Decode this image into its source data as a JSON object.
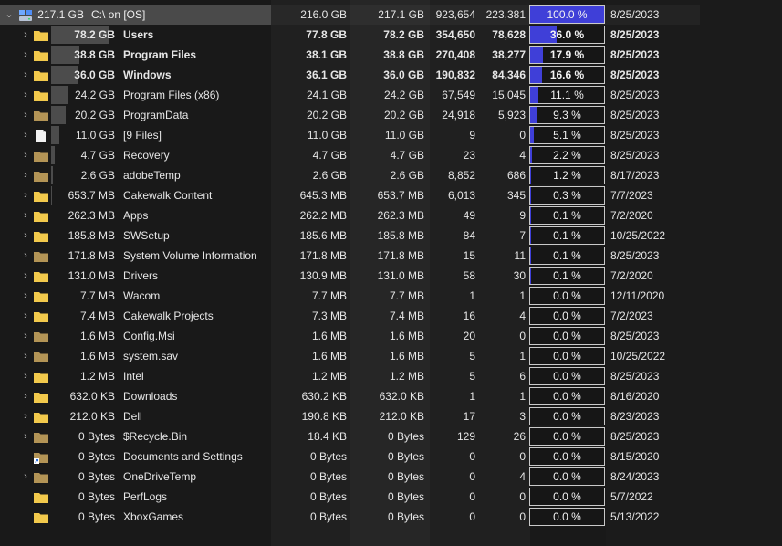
{
  "root": {
    "size": "217.1 GB",
    "name": "C:\\  on  [OS]",
    "a1": "216.0 GB",
    "a2": "217.1 GB",
    "a3": "923,654",
    "a4": "223,381",
    "pct": "100.0 %",
    "pct_value": 100.0,
    "date": "8/25/2023"
  },
  "rows": [
    {
      "size": "78.2 GB",
      "name": "Users",
      "a1": "77.8 GB",
      "a2": "78.2 GB",
      "a3": "354,650",
      "a4": "78,628",
      "pct": "36.0 %",
      "pv": 36.0,
      "date": "8/25/2023",
      "icon": "folder-icon",
      "bold": true,
      "chev": true
    },
    {
      "size": "38.8 GB",
      "name": "Program Files",
      "a1": "38.1 GB",
      "a2": "38.8 GB",
      "a3": "270,408",
      "a4": "38,277",
      "pct": "17.9 %",
      "pv": 17.9,
      "date": "8/25/2023",
      "icon": "folder-icon",
      "bold": true,
      "chev": true
    },
    {
      "size": "36.0 GB",
      "name": "Windows",
      "a1": "36.1 GB",
      "a2": "36.0 GB",
      "a3": "190,832",
      "a4": "84,346",
      "pct": "16.6 %",
      "pv": 16.6,
      "date": "8/25/2023",
      "icon": "folder-icon",
      "bold": true,
      "chev": true
    },
    {
      "size": "24.2 GB",
      "name": "Program Files (x86)",
      "a1": "24.1 GB",
      "a2": "24.2 GB",
      "a3": "67,549",
      "a4": "15,045",
      "pct": "11.1 %",
      "pv": 11.1,
      "date": "8/25/2023",
      "icon": "folder-icon",
      "bold": false,
      "chev": true
    },
    {
      "size": "20.2 GB",
      "name": "ProgramData",
      "a1": "20.2 GB",
      "a2": "20.2 GB",
      "a3": "24,918",
      "a4": "5,923",
      "pct": "9.3 %",
      "pv": 9.3,
      "date": "8/25/2023",
      "icon": "folder-dark-icon",
      "bold": false,
      "chev": true
    },
    {
      "size": "11.0 GB",
      "name": "[9 Files]",
      "a1": "11.0 GB",
      "a2": "11.0 GB",
      "a3": "9",
      "a4": "0",
      "pct": "5.1 %",
      "pv": 5.1,
      "date": "8/25/2023",
      "icon": "file-icon",
      "bold": false,
      "chev": true
    },
    {
      "size": "4.7 GB",
      "name": "Recovery",
      "a1": "4.7 GB",
      "a2": "4.7 GB",
      "a3": "23",
      "a4": "4",
      "pct": "2.2 %",
      "pv": 2.2,
      "date": "8/25/2023",
      "icon": "folder-dark-icon",
      "bold": false,
      "chev": true
    },
    {
      "size": "2.6 GB",
      "name": "adobeTemp",
      "a1": "2.6 GB",
      "a2": "2.6 GB",
      "a3": "8,852",
      "a4": "686",
      "pct": "1.2 %",
      "pv": 1.2,
      "date": "8/17/2023",
      "icon": "folder-dark-icon",
      "bold": false,
      "chev": true
    },
    {
      "size": "653.7 MB",
      "name": "Cakewalk Content",
      "a1": "645.3 MB",
      "a2": "653.7 MB",
      "a3": "6,013",
      "a4": "345",
      "pct": "0.3 %",
      "pv": 0.3,
      "date": "7/7/2023",
      "icon": "folder-icon",
      "bold": false,
      "chev": true
    },
    {
      "size": "262.3 MB",
      "name": "Apps",
      "a1": "262.2 MB",
      "a2": "262.3 MB",
      "a3": "49",
      "a4": "9",
      "pct": "0.1 %",
      "pv": 0.1,
      "date": "7/2/2020",
      "icon": "folder-icon",
      "bold": false,
      "chev": true
    },
    {
      "size": "185.8 MB",
      "name": "SWSetup",
      "a1": "185.6 MB",
      "a2": "185.8 MB",
      "a3": "84",
      "a4": "7",
      "pct": "0.1 %",
      "pv": 0.1,
      "date": "10/25/2022",
      "icon": "folder-icon",
      "bold": false,
      "chev": true
    },
    {
      "size": "171.8 MB",
      "name": "System Volume Information",
      "a1": "171.8 MB",
      "a2": "171.8 MB",
      "a3": "15",
      "a4": "11",
      "pct": "0.1 %",
      "pv": 0.1,
      "date": "8/25/2023",
      "icon": "folder-dark-icon",
      "bold": false,
      "chev": true
    },
    {
      "size": "131.0 MB",
      "name": "Drivers",
      "a1": "130.9 MB",
      "a2": "131.0 MB",
      "a3": "58",
      "a4": "30",
      "pct": "0.1 %",
      "pv": 0.1,
      "date": "7/2/2020",
      "icon": "folder-icon",
      "bold": false,
      "chev": true
    },
    {
      "size": "7.7 MB",
      "name": "Wacom",
      "a1": "7.7 MB",
      "a2": "7.7 MB",
      "a3": "1",
      "a4": "1",
      "pct": "0.0 %",
      "pv": 0.0,
      "date": "12/11/2020",
      "icon": "folder-icon",
      "bold": false,
      "chev": true
    },
    {
      "size": "7.4 MB",
      "name": "Cakewalk Projects",
      "a1": "7.3 MB",
      "a2": "7.4 MB",
      "a3": "16",
      "a4": "4",
      "pct": "0.0 %",
      "pv": 0.0,
      "date": "7/2/2023",
      "icon": "folder-icon",
      "bold": false,
      "chev": true
    },
    {
      "size": "1.6 MB",
      "name": "Config.Msi",
      "a1": "1.6 MB",
      "a2": "1.6 MB",
      "a3": "20",
      "a4": "0",
      "pct": "0.0 %",
      "pv": 0.0,
      "date": "8/25/2023",
      "icon": "folder-dark-icon",
      "bold": false,
      "chev": true
    },
    {
      "size": "1.6 MB",
      "name": "system.sav",
      "a1": "1.6 MB",
      "a2": "1.6 MB",
      "a3": "5",
      "a4": "1",
      "pct": "0.0 %",
      "pv": 0.0,
      "date": "10/25/2022",
      "icon": "folder-dark-icon",
      "bold": false,
      "chev": true
    },
    {
      "size": "1.2 MB",
      "name": "Intel",
      "a1": "1.2 MB",
      "a2": "1.2 MB",
      "a3": "5",
      "a4": "6",
      "pct": "0.0 %",
      "pv": 0.0,
      "date": "8/25/2023",
      "icon": "folder-icon",
      "bold": false,
      "chev": true
    },
    {
      "size": "632.0 KB",
      "name": "Downloads",
      "a1": "630.2 KB",
      "a2": "632.0 KB",
      "a3": "1",
      "a4": "1",
      "pct": "0.0 %",
      "pv": 0.0,
      "date": "8/16/2020",
      "icon": "folder-icon",
      "bold": false,
      "chev": true
    },
    {
      "size": "212.0 KB",
      "name": "Dell",
      "a1": "190.8 KB",
      "a2": "212.0 KB",
      "a3": "17",
      "a4": "3",
      "pct": "0.0 %",
      "pv": 0.0,
      "date": "8/23/2023",
      "icon": "folder-icon",
      "bold": false,
      "chev": true
    },
    {
      "size": "0 Bytes",
      "name": "$Recycle.Bin",
      "a1": "18.4 KB",
      "a2": "0 Bytes",
      "a3": "129",
      "a4": "26",
      "pct": "0.0 %",
      "pv": 0.0,
      "date": "8/25/2023",
      "icon": "folder-dark-icon",
      "bold": false,
      "chev": true
    },
    {
      "size": "0 Bytes",
      "name": "Documents and Settings",
      "a1": "0 Bytes",
      "a2": "0 Bytes",
      "a3": "0",
      "a4": "0",
      "pct": "0.0 %",
      "pv": 0.0,
      "date": "8/15/2020",
      "icon": "folder-shortcut-icon",
      "bold": false,
      "chev": false
    },
    {
      "size": "0 Bytes",
      "name": "OneDriveTemp",
      "a1": "0 Bytes",
      "a2": "0 Bytes",
      "a3": "0",
      "a4": "4",
      "pct": "0.0 %",
      "pv": 0.0,
      "date": "8/24/2023",
      "icon": "folder-dark-icon",
      "bold": false,
      "chev": true
    },
    {
      "size": "0 Bytes",
      "name": "PerfLogs",
      "a1": "0 Bytes",
      "a2": "0 Bytes",
      "a3": "0",
      "a4": "0",
      "pct": "0.0 %",
      "pv": 0.0,
      "date": "5/7/2022",
      "icon": "folder-icon",
      "bold": false,
      "chev": false
    },
    {
      "size": "0 Bytes",
      "name": "XboxGames",
      "a1": "0 Bytes",
      "a2": "0 Bytes",
      "a3": "0",
      "a4": "0",
      "pct": "0.0 %",
      "pv": 0.0,
      "date": "5/13/2022",
      "icon": "folder-icon",
      "bold": false,
      "chev": false
    }
  ],
  "colors": {
    "accent": "#3f3fd8",
    "folder": "#f2c94c",
    "folder_dark": "#b39456",
    "background": "#191919",
    "root_row": "#4a4a4a",
    "size_bar": "#4c4c4c"
  }
}
